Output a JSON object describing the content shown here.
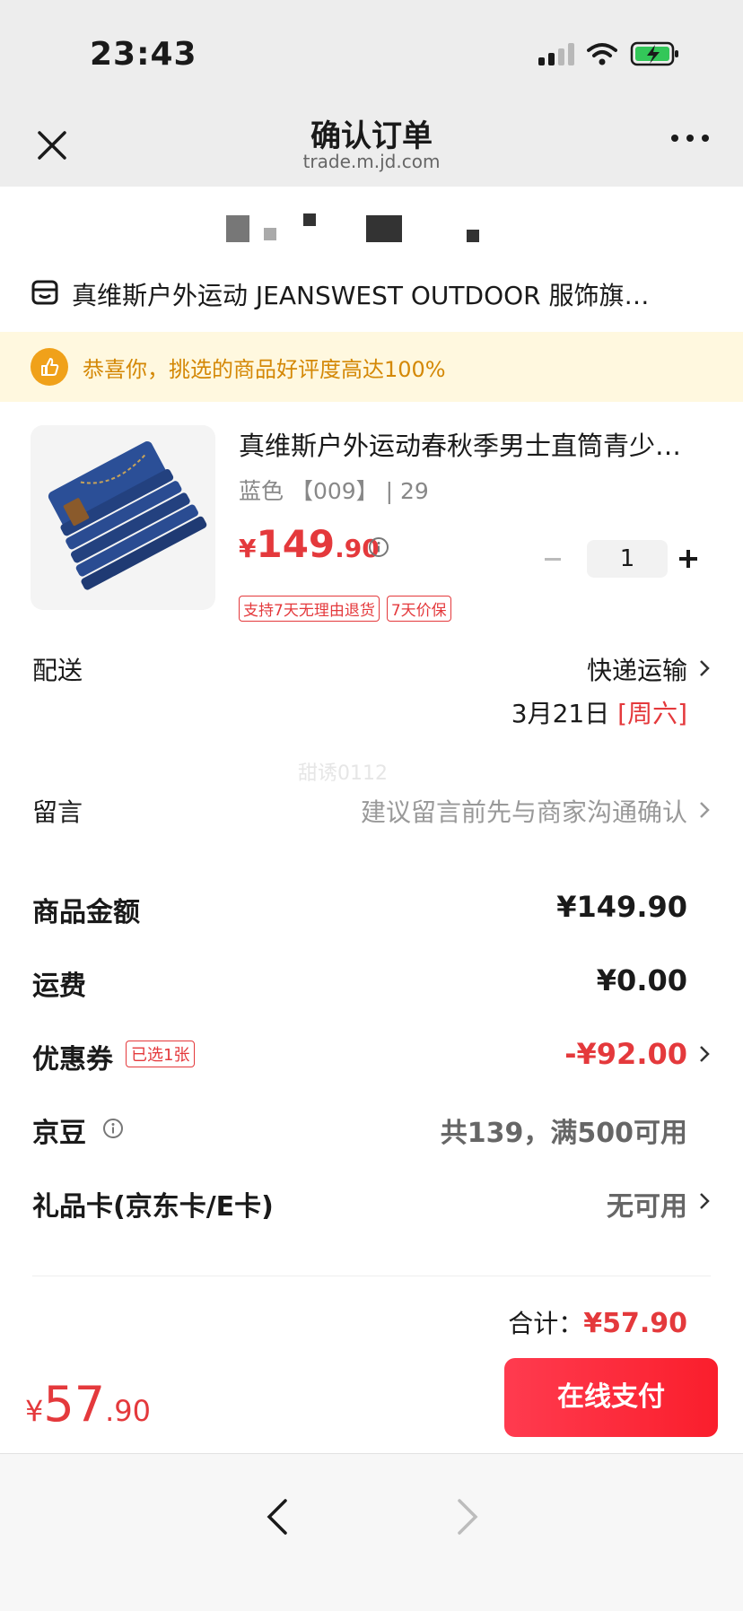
{
  "status_bar": {
    "time": "23:43"
  },
  "title_bar": {
    "title": "确认订单",
    "url": "trade.m.jd.com"
  },
  "shop": {
    "name": "真维斯户外运动 JEANSWEST OUTDOOR 服饰旗…"
  },
  "notice": {
    "text": "恭喜你，挑选的商品好评度高达100%"
  },
  "product": {
    "title": "真维斯户外运动春秋季男士直筒青少…",
    "spec": "蓝色 【009】 | 29",
    "price_symbol": "¥",
    "price_int": "149",
    "price_dec": ".90",
    "quantity": "1",
    "tags": [
      "支持7天无理由退货",
      "7天价保"
    ]
  },
  "delivery": {
    "label": "配送",
    "method": "快递运输",
    "date": "3月21日",
    "weekday": "[周六]"
  },
  "watermark": "甜诱0112",
  "message": {
    "label": "留言",
    "placeholder": "建议留言前先与商家沟通确认"
  },
  "summary": {
    "goods_amount": {
      "label": "商品金额",
      "value": "¥149.90"
    },
    "shipping": {
      "label": "运费",
      "value": "¥0.00"
    },
    "coupon": {
      "label": "优惠券",
      "badge": "已选1张",
      "value": "-¥92.00"
    },
    "jingdou": {
      "label": "京豆",
      "value": "共139，满500可用"
    },
    "gift_card": {
      "label": "礼品卡(京东卡/E卡)",
      "value": "无可用"
    },
    "total_label": "合计：",
    "total_value": "¥57.90"
  },
  "pay": {
    "symbol": "¥",
    "int": "57",
    "dec": ".90",
    "button_label": "在线支付"
  },
  "colors": {
    "accent_red": "#e4393c",
    "notice_orange": "#d48806"
  }
}
